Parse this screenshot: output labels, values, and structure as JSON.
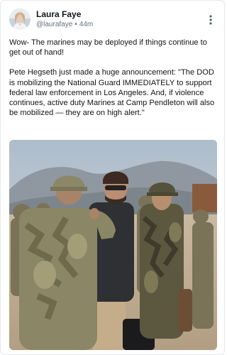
{
  "post": {
    "author": {
      "name": "Laura Faye",
      "handle": "@laurafaye",
      "time": "44m"
    },
    "paragraphs": [
      "Wow- The marines may be deployed if things continue to get out of hand!",
      "Pete Hegseth just made a huge announcement: \"The DOD is mobilizing the National Guard IMMEDIATELY to support federal law enforcement in Los Angeles. And, if violence continues, active duty Marines at Camp Pendleton will also be mobilized — they are on high alert.\""
    ],
    "meta_separator": "•",
    "more_icon": "vertical-ellipsis-icon",
    "photo_description_icon": "photo"
  },
  "colors": {
    "name": "#111418",
    "meta": "#66707a",
    "text": "#141414",
    "border": "#e6e8eb"
  }
}
